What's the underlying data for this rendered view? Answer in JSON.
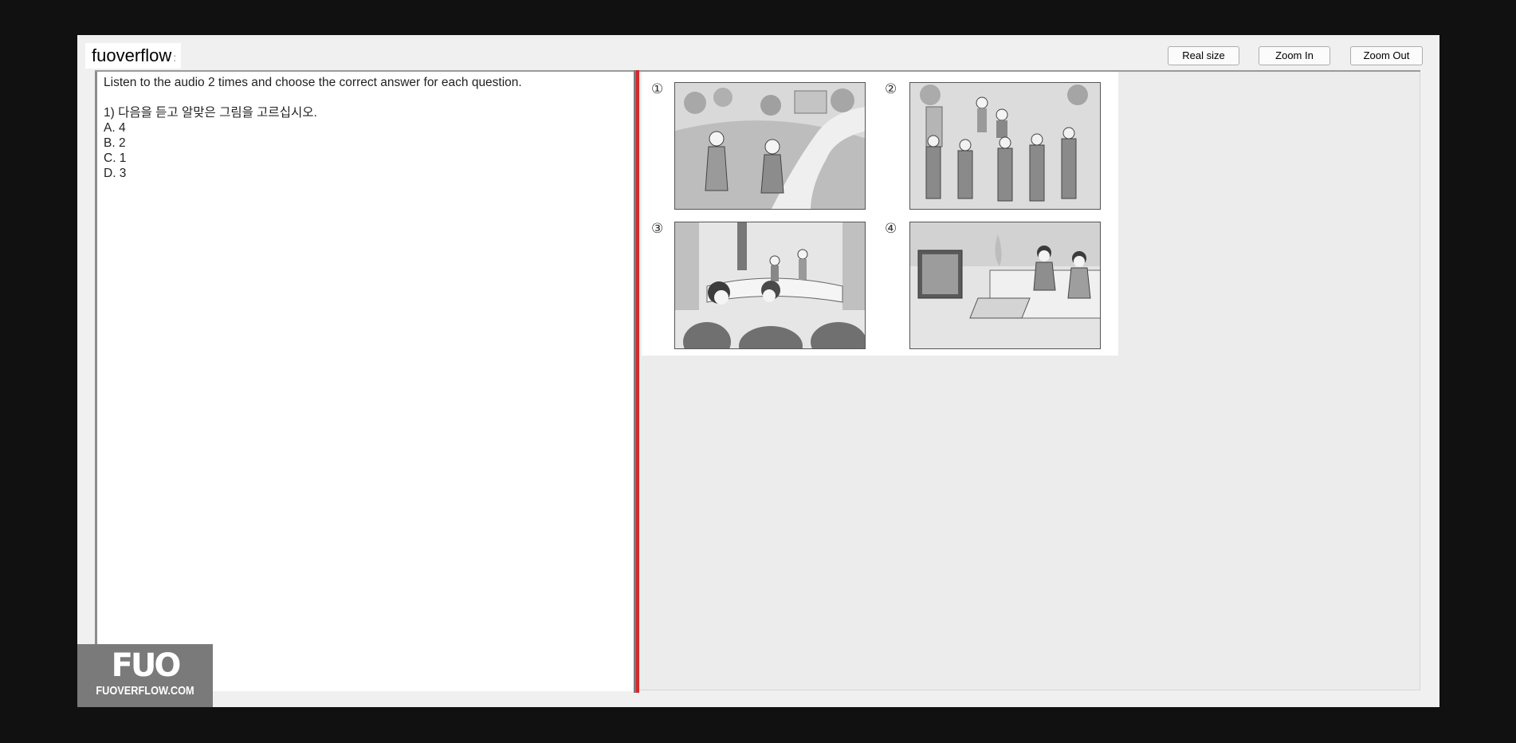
{
  "window": {
    "title": "fuoverflow"
  },
  "toolbar": {
    "real_size_label": "Real size",
    "zoom_in_label": "Zoom In",
    "zoom_out_label": "Zoom Out"
  },
  "question": {
    "instruction": "Listen to the audio 2 times and choose the correct answer for each question.",
    "prompt": "1) 다음을 듣고 알맞은 그림을 고르십시오.",
    "options": [
      "A. 4",
      "B. 2",
      "C. 1",
      "D. 3"
    ]
  },
  "figure": {
    "panel_labels": [
      "①",
      "②",
      "③",
      "④"
    ]
  },
  "watermark": {
    "logo_text": "FUO",
    "site": "FUOVERFLOW.COM"
  },
  "colors": {
    "splitter": "#d42a2a",
    "window_bg": "#f0f0f0",
    "page_bg": "#111111"
  }
}
